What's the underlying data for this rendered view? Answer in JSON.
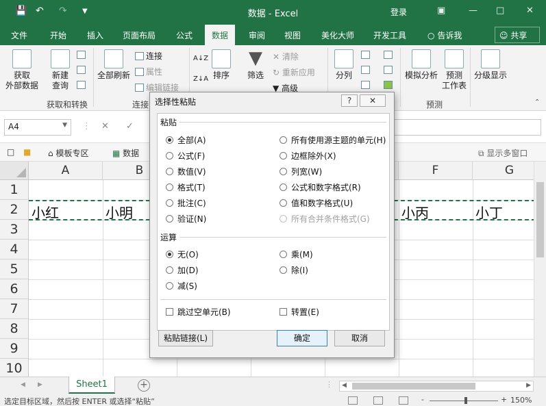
{
  "titlebar": {
    "title": "数据 - Excel",
    "login": "登录"
  },
  "menu": {
    "tabs": [
      "文件",
      "开始",
      "插入",
      "页面布局",
      "公式",
      "数据",
      "审阅",
      "视图",
      "美化大师",
      "开发工具"
    ],
    "tell_me": "告诉我",
    "share": "共享"
  },
  "ribbon": {
    "get_data": "获取\n外部数据",
    "new_query": "新建\n查询",
    "show_query_small": [
      "",
      "",
      ""
    ],
    "refresh_all": "全部刷新",
    "connections": "连接",
    "properties": "属性",
    "edit_links": "编辑链接",
    "sort": "排序",
    "filter": "筛选",
    "clear": "清除",
    "reapply": "重新应用",
    "advanced": "高级",
    "split": "分列",
    "whatif": "模拟分析",
    "forecast": "预测\n工作表",
    "outline": "分级显示",
    "groups": {
      "get_transform": "获取和转换",
      "connections": "连接",
      "forecast": "预测"
    }
  },
  "formula_bar": {
    "name_box": "A4",
    "value": ""
  },
  "workbook_tabs": {
    "template": "模板专区",
    "file": "数据",
    "show_windows": "显示多窗口"
  },
  "grid": {
    "columns": [
      "A",
      "B",
      "C",
      "D",
      "E",
      "F",
      "G"
    ],
    "rows": [
      "1",
      "2",
      "3",
      "4",
      "5",
      "6",
      "7",
      "8",
      "9",
      "10"
    ],
    "cells": {
      "A2": "小红",
      "B2": "小明",
      "F2": "小丙",
      "G2": "小丁"
    }
  },
  "sheets": {
    "active": "Sheet1"
  },
  "status": {
    "message": "选定目标区域，然后按 ENTER 或选择“粘贴”",
    "zoom": "150%"
  },
  "dialog": {
    "title": "选择性粘贴",
    "help": "?",
    "paste_label": "粘贴",
    "paste_left": [
      "全部(A)",
      "公式(F)",
      "数值(V)",
      "格式(T)",
      "批注(C)",
      "验证(N)"
    ],
    "paste_right": [
      "所有使用源主题的单元(H)",
      "边框除外(X)",
      "列宽(W)",
      "公式和数字格式(R)",
      "值和数字格式(U)",
      "所有合并条件格式(G)"
    ],
    "operation_label": "运算",
    "op_left": [
      "无(O)",
      "加(D)",
      "减(S)"
    ],
    "op_right": [
      "乘(M)",
      "除(I)"
    ],
    "skip_blanks": "跳过空单元(B)",
    "transpose": "转置(E)",
    "paste_link": "粘贴链接(L)",
    "ok": "确定",
    "cancel": "取消"
  }
}
